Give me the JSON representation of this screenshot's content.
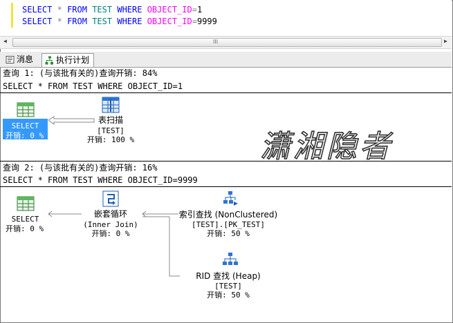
{
  "editor": {
    "line1": {
      "select": "SELECT",
      "star": "*",
      "from": "FROM",
      "table": "TEST",
      "where": "WHERE",
      "fn": "OBJECT_ID",
      "eq": "=",
      "val": "1"
    },
    "line2": {
      "select": "SELECT",
      "star": "*",
      "from": "FROM",
      "table": "TEST",
      "where": "WHERE",
      "fn": "OBJECT_ID",
      "eq": "=",
      "val": "9999"
    }
  },
  "scrollbar": {
    "grip": "III",
    "left_arrow": "◀",
    "right_arrow": "▶"
  },
  "tabs": [
    {
      "label": "消息",
      "icon": "messages-icon"
    },
    {
      "label": "执行计划",
      "icon": "execution-plan-icon"
    }
  ],
  "query1": {
    "header": "查询 1: (与该批有关的)查询开销: 84%",
    "sql": "SELECT * FROM TEST WHERE OBJECT_ID=1",
    "select_node": {
      "name": "SELECT",
      "cost": "开销: 0 %"
    },
    "scan_node": {
      "name": "表扫描",
      "object": "[TEST]",
      "cost": "开销: 100 %"
    }
  },
  "query2": {
    "header": "查询 2: (与该批有关的)查询开销: 16%",
    "sql": "SELECT * FROM TEST WHERE OBJECT_ID=9999",
    "select_node": {
      "name": "SELECT",
      "cost": "开销: 0 %"
    },
    "loop_node": {
      "name": "嵌套循环",
      "detail": "(Inner Join)",
      "cost": "开销: 0 %"
    },
    "seek_node": {
      "name": "索引查找 (NonClustered)",
      "object": "[TEST].[PK_TEST]",
      "cost": "开销: 50 %"
    },
    "rid_node": {
      "name": "RID 查找 (Heap)",
      "object": "[TEST]",
      "cost": "开销: 50 %"
    }
  },
  "watermark": "潇湘隐者",
  "colors": {
    "keyword": "#0000ff",
    "object": "#008080",
    "function": "#ff00ff",
    "selection": "#3399ff"
  }
}
